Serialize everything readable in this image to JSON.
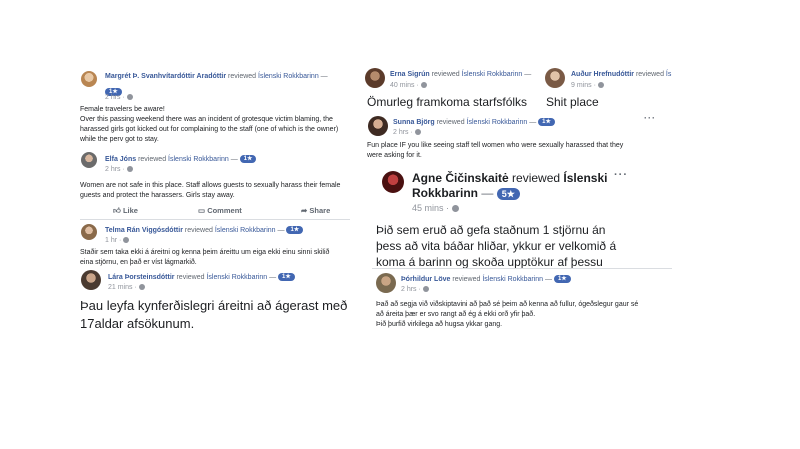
{
  "left_panel": {
    "review1": {
      "author": "Margrét Þ. Svanhvítardóttir Aradóttir",
      "action": "reviewed",
      "page": "Íslenski Rokkbarinn",
      "dash": "—",
      "rating": "1★",
      "time": "2 hrs",
      "line1": "Female travelers be aware!",
      "line2": "Over this passing weekend there was an incident of grotesque victim blaming, the",
      "line3": "harassed girls got kicked out for complaining to the staff (one of which is the owner)",
      "line4": "while the perv got to stay."
    },
    "review2": {
      "author": "Elfa Jóns",
      "action": "reviewed",
      "page": "Íslenski Rokkbarinn",
      "dash": "—",
      "rating": "1★",
      "time": "2 hrs",
      "line1": "Women are not safe in this place. Staff allows guests to sexually harass their female",
      "line2": "guests and protect the harassers. Girls stay away.",
      "like": "Like",
      "comment": "Comment",
      "share": "Share"
    },
    "review3": {
      "author": "Telma Rán Viggósdóttir",
      "action": "reviewed",
      "page": "Íslenski Rokkbarinn",
      "dash": "—",
      "rating": "1★",
      "time": "1 hr",
      "line1": "Staðir sem taka ekki á áreitni og kenna þeim áreittu um eiga ekki einu sinni skilið",
      "line2": "eina stjörnu, en það er víst lágmarkið."
    },
    "review4": {
      "author": "Lára Þorsteinsdóttir",
      "action": "reviewed",
      "page": "Íslenski Rokkbarinn",
      "dash": "—",
      "rating": "1★",
      "time": "21 mins",
      "line1": "Þau leyfa kynferðislegri áreitni að ágerast með",
      "line2": "17aldar afsökunum."
    }
  },
  "right_panel": {
    "review5": {
      "author": "Erna Sigrún",
      "action": "reviewed",
      "page": "Íslenski Rokkbarinn",
      "dash": "—",
      "time": "40 mins",
      "text": "Ömurleg framkoma starfsfólks"
    },
    "review6": {
      "author": "Auður Hrefnudóttir",
      "action": "reviewed",
      "page": "Ís",
      "time": "9 mins",
      "text": "Shit place"
    },
    "review7": {
      "author": "Sunna Björg",
      "action": "reviewed",
      "page": "Íslenski Rokkbarinn",
      "dash": "—",
      "rating": "1★",
      "time": "2 hrs",
      "line1": "Fun place IF you like seeing staff tell women who were sexually harassed that they",
      "line2": "were asking for it."
    },
    "review8": {
      "author": "Agne Čičinskaitė",
      "action": "reviewed",
      "page_line1": "Íslenski",
      "page_line2": "Rokkbarinn",
      "dash": "—",
      "rating": "5★",
      "time": "45 mins",
      "line1": "Þið sem eruð að gefa staðnum 1 stjörnu án",
      "line2": "þess að vita báðar hliðar, ykkur er velkomið á",
      "line3": "koma á barinn og skoða upptökur af þessu"
    },
    "review9": {
      "author": "Þórhildur Löve",
      "action": "reviewed",
      "page": "Íslenski Rokkbarinn",
      "dash": "—",
      "rating": "1★",
      "time": "2 hrs",
      "line1": "Það að segja við viðskiptavini að það sé þeim að kenna að fullur, ógeðslegur gaur sé",
      "line2": "að áreita þær er svo rangt að ég á ekki orð yfir það.",
      "line3": "Þið þurfið virkilega að hugsa ykkar gang."
    }
  },
  "colors": {
    "link": "#385898",
    "badge": "#4267b2",
    "meta": "#90949c"
  },
  "icons": [
    "like-icon",
    "comment-icon",
    "share-icon",
    "globe-icon",
    "more-options-icon"
  ]
}
